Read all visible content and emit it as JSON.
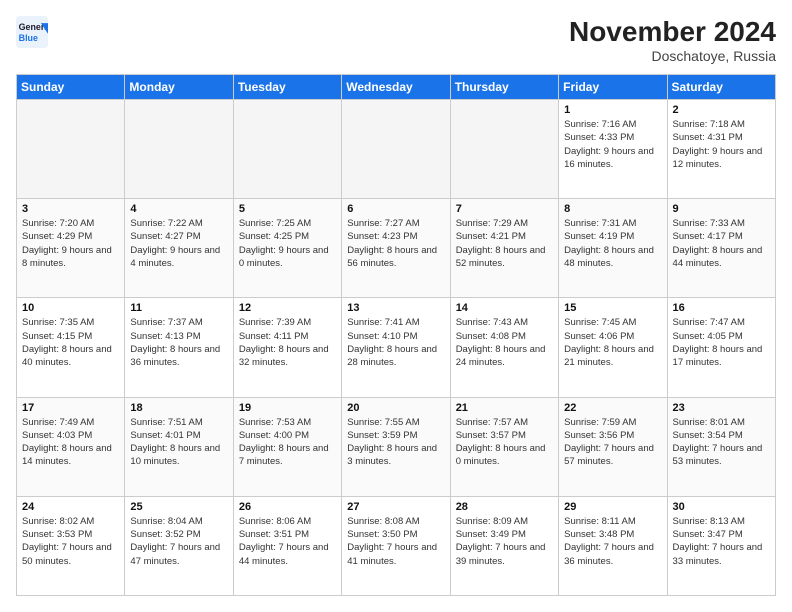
{
  "header": {
    "logo_line1": "General",
    "logo_line2": "Blue",
    "month": "November 2024",
    "location": "Doschatoye, Russia"
  },
  "days_of_week": [
    "Sunday",
    "Monday",
    "Tuesday",
    "Wednesday",
    "Thursday",
    "Friday",
    "Saturday"
  ],
  "weeks": [
    [
      {
        "day": "",
        "info": ""
      },
      {
        "day": "",
        "info": ""
      },
      {
        "day": "",
        "info": ""
      },
      {
        "day": "",
        "info": ""
      },
      {
        "day": "",
        "info": ""
      },
      {
        "day": "1",
        "info": "Sunrise: 7:16 AM\nSunset: 4:33 PM\nDaylight: 9 hours and 16 minutes."
      },
      {
        "day": "2",
        "info": "Sunrise: 7:18 AM\nSunset: 4:31 PM\nDaylight: 9 hours and 12 minutes."
      }
    ],
    [
      {
        "day": "3",
        "info": "Sunrise: 7:20 AM\nSunset: 4:29 PM\nDaylight: 9 hours and 8 minutes."
      },
      {
        "day": "4",
        "info": "Sunrise: 7:22 AM\nSunset: 4:27 PM\nDaylight: 9 hours and 4 minutes."
      },
      {
        "day": "5",
        "info": "Sunrise: 7:25 AM\nSunset: 4:25 PM\nDaylight: 9 hours and 0 minutes."
      },
      {
        "day": "6",
        "info": "Sunrise: 7:27 AM\nSunset: 4:23 PM\nDaylight: 8 hours and 56 minutes."
      },
      {
        "day": "7",
        "info": "Sunrise: 7:29 AM\nSunset: 4:21 PM\nDaylight: 8 hours and 52 minutes."
      },
      {
        "day": "8",
        "info": "Sunrise: 7:31 AM\nSunset: 4:19 PM\nDaylight: 8 hours and 48 minutes."
      },
      {
        "day": "9",
        "info": "Sunrise: 7:33 AM\nSunset: 4:17 PM\nDaylight: 8 hours and 44 minutes."
      }
    ],
    [
      {
        "day": "10",
        "info": "Sunrise: 7:35 AM\nSunset: 4:15 PM\nDaylight: 8 hours and 40 minutes."
      },
      {
        "day": "11",
        "info": "Sunrise: 7:37 AM\nSunset: 4:13 PM\nDaylight: 8 hours and 36 minutes."
      },
      {
        "day": "12",
        "info": "Sunrise: 7:39 AM\nSunset: 4:11 PM\nDaylight: 8 hours and 32 minutes."
      },
      {
        "day": "13",
        "info": "Sunrise: 7:41 AM\nSunset: 4:10 PM\nDaylight: 8 hours and 28 minutes."
      },
      {
        "day": "14",
        "info": "Sunrise: 7:43 AM\nSunset: 4:08 PM\nDaylight: 8 hours and 24 minutes."
      },
      {
        "day": "15",
        "info": "Sunrise: 7:45 AM\nSunset: 4:06 PM\nDaylight: 8 hours and 21 minutes."
      },
      {
        "day": "16",
        "info": "Sunrise: 7:47 AM\nSunset: 4:05 PM\nDaylight: 8 hours and 17 minutes."
      }
    ],
    [
      {
        "day": "17",
        "info": "Sunrise: 7:49 AM\nSunset: 4:03 PM\nDaylight: 8 hours and 14 minutes."
      },
      {
        "day": "18",
        "info": "Sunrise: 7:51 AM\nSunset: 4:01 PM\nDaylight: 8 hours and 10 minutes."
      },
      {
        "day": "19",
        "info": "Sunrise: 7:53 AM\nSunset: 4:00 PM\nDaylight: 8 hours and 7 minutes."
      },
      {
        "day": "20",
        "info": "Sunrise: 7:55 AM\nSunset: 3:59 PM\nDaylight: 8 hours and 3 minutes."
      },
      {
        "day": "21",
        "info": "Sunrise: 7:57 AM\nSunset: 3:57 PM\nDaylight: 8 hours and 0 minutes."
      },
      {
        "day": "22",
        "info": "Sunrise: 7:59 AM\nSunset: 3:56 PM\nDaylight: 7 hours and 57 minutes."
      },
      {
        "day": "23",
        "info": "Sunrise: 8:01 AM\nSunset: 3:54 PM\nDaylight: 7 hours and 53 minutes."
      }
    ],
    [
      {
        "day": "24",
        "info": "Sunrise: 8:02 AM\nSunset: 3:53 PM\nDaylight: 7 hours and 50 minutes."
      },
      {
        "day": "25",
        "info": "Sunrise: 8:04 AM\nSunset: 3:52 PM\nDaylight: 7 hours and 47 minutes."
      },
      {
        "day": "26",
        "info": "Sunrise: 8:06 AM\nSunset: 3:51 PM\nDaylight: 7 hours and 44 minutes."
      },
      {
        "day": "27",
        "info": "Sunrise: 8:08 AM\nSunset: 3:50 PM\nDaylight: 7 hours and 41 minutes."
      },
      {
        "day": "28",
        "info": "Sunrise: 8:09 AM\nSunset: 3:49 PM\nDaylight: 7 hours and 39 minutes."
      },
      {
        "day": "29",
        "info": "Sunrise: 8:11 AM\nSunset: 3:48 PM\nDaylight: 7 hours and 36 minutes."
      },
      {
        "day": "30",
        "info": "Sunrise: 8:13 AM\nSunset: 3:47 PM\nDaylight: 7 hours and 33 minutes."
      }
    ]
  ]
}
